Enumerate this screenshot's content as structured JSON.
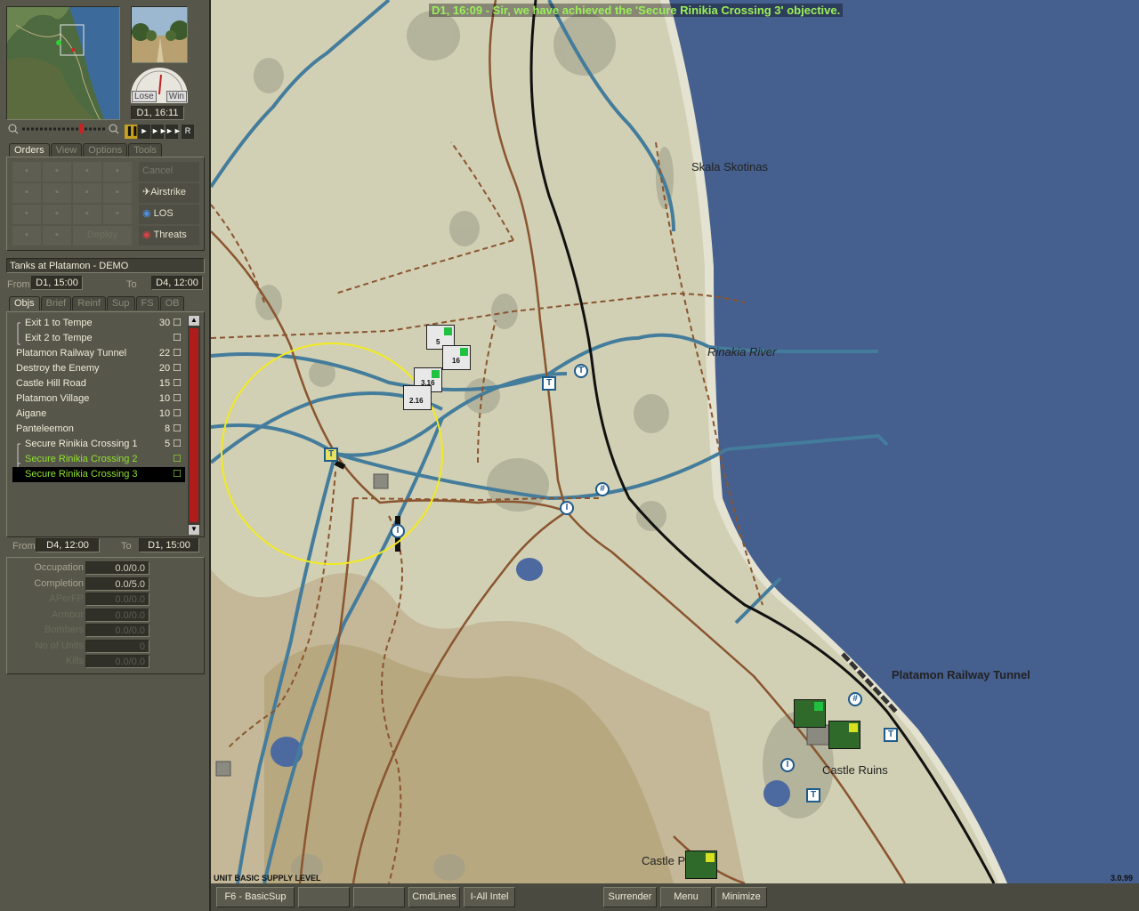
{
  "colors": {
    "sea": "#455f8e",
    "land": "#d2d0b4",
    "river": "#447c9c",
    "road": "#8a5530",
    "rail": "#111111",
    "message": "#9cf05a",
    "highlight": "#90e030"
  },
  "minimap": {
    "turn": "D1, 16:11",
    "lose_label": "Lose",
    "win_label": "Win"
  },
  "playback": {
    "pause": "▐▐",
    "play": "►",
    "fast": "►►",
    "faster": "►►►",
    "replay": "R"
  },
  "tabs": {
    "orders": "Orders",
    "view": "View",
    "options": "Options",
    "tools": "Tools"
  },
  "orders": {
    "cancel": "Cancel",
    "airstrike": "Airstrike",
    "los": "LOS",
    "threats": "Threats",
    "deploy": "Deploy"
  },
  "scenario": {
    "name": "Tanks at Platamon - DEMO",
    "from_label": "From",
    "from_value": "D1, 15:00",
    "to_label": "To",
    "to_value": "D4, 12:00"
  },
  "obj_tabs": [
    "Objs",
    "Brief",
    "Reinf",
    "Sup",
    "FS",
    "OB"
  ],
  "objectives": [
    {
      "name": "Exit 1 to Tempe",
      "points": "30"
    },
    {
      "name": "Exit 2 to Tempe",
      "points": ""
    },
    {
      "name": "Platamon Railway Tunnel",
      "points": "22"
    },
    {
      "name": "Destroy the Enemy",
      "points": "20"
    },
    {
      "name": "Castle Hill Road",
      "points": "15"
    },
    {
      "name": "Platamon Village",
      "points": "10"
    },
    {
      "name": "Aigane",
      "points": "10"
    },
    {
      "name": "Panteleemon",
      "points": "8"
    },
    {
      "name": "Secure Rinikia Crossing 1",
      "points": "5"
    },
    {
      "name": "Secure Rinikia Crossing 2",
      "points": ""
    },
    {
      "name": "Secure Rinikia Crossing 3",
      "points": ""
    }
  ],
  "obj_range": {
    "from_label": "From",
    "from_value": "D4, 12:00",
    "to_label": "To",
    "to_value": "D1, 15:00"
  },
  "stats": [
    {
      "label": "Occupation",
      "value": "0.0/0.0"
    },
    {
      "label": "Completion",
      "value": "0.0/5.0"
    },
    {
      "label": "APerFP",
      "value": "0.0/0.0"
    },
    {
      "label": "Armour",
      "value": "0.0/0.0"
    },
    {
      "label": "Bombers",
      "value": "0.0/0.0"
    },
    {
      "label": "No of Units",
      "value": "0"
    },
    {
      "label": "Kills",
      "value": "0.0/0.0"
    }
  ],
  "map": {
    "message": "D1, 16:09 - Sir, we have achieved the 'Secure Rinikia Crossing 3' objective.",
    "places": {
      "skala": "Skala Skotinas",
      "river": "Rinakia River",
      "tunnel": "Platamon Railway Tunnel",
      "ruins": "Castle Ruins",
      "castle": "Castle P"
    },
    "units": {
      "u1": "5",
      "u2": "16",
      "u3": "3.16",
      "u4": "2.16"
    },
    "supply_level": "UNIT BASIC SUPPLY LEVEL",
    "version": "3.0.99"
  },
  "bottom": {
    "basicsup": "F6 - BasicSup",
    "cmdlines": "CmdLines",
    "intel": "I-All Intel",
    "surrender": "Surrender",
    "menu": "Menu",
    "minimize": "Minimize"
  }
}
